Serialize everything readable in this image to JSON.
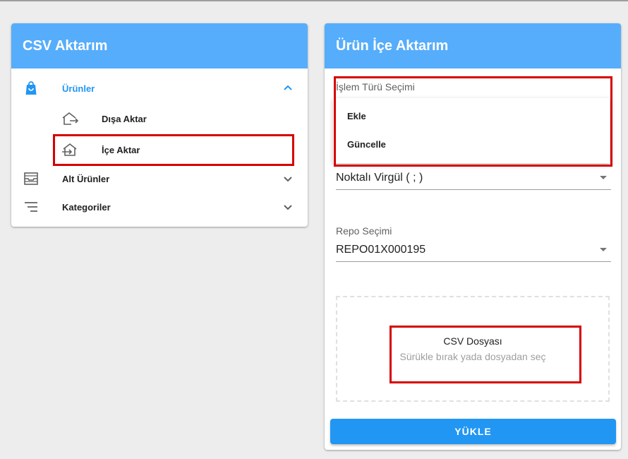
{
  "left_card": {
    "title": "CSV Aktarım",
    "nav": [
      {
        "label": "Ürünler",
        "icon": "shopping-bag-icon",
        "expanded": true,
        "children": [
          {
            "label": "Dışa Aktar",
            "icon": "export-icon"
          },
          {
            "label": "İçe Aktar",
            "icon": "import-icon"
          }
        ]
      },
      {
        "label": "Alt Ürünler",
        "icon": "inbox-icon",
        "expanded": false
      },
      {
        "label": "Kategoriler",
        "icon": "list-icon",
        "expanded": false
      }
    ]
  },
  "right_card": {
    "title": "Ürün İçe Aktarım",
    "operation_type": {
      "label": "İşlem Türü Seçimi",
      "options": [
        "Ekle",
        "Güncelle"
      ]
    },
    "delimiter": {
      "value": "Noktalı Virgül ( ; )"
    },
    "repo": {
      "label": "Repo Seçimi",
      "value": "REPO01X000195"
    },
    "dropzone": {
      "title": "CSV Dosyası",
      "subtitle": "Sürükle bırak yada dosyadan seç"
    },
    "upload_label": "YÜKLE"
  },
  "colors": {
    "header": "#56adfb",
    "accent": "#2196f3",
    "highlight": "#d60000"
  }
}
